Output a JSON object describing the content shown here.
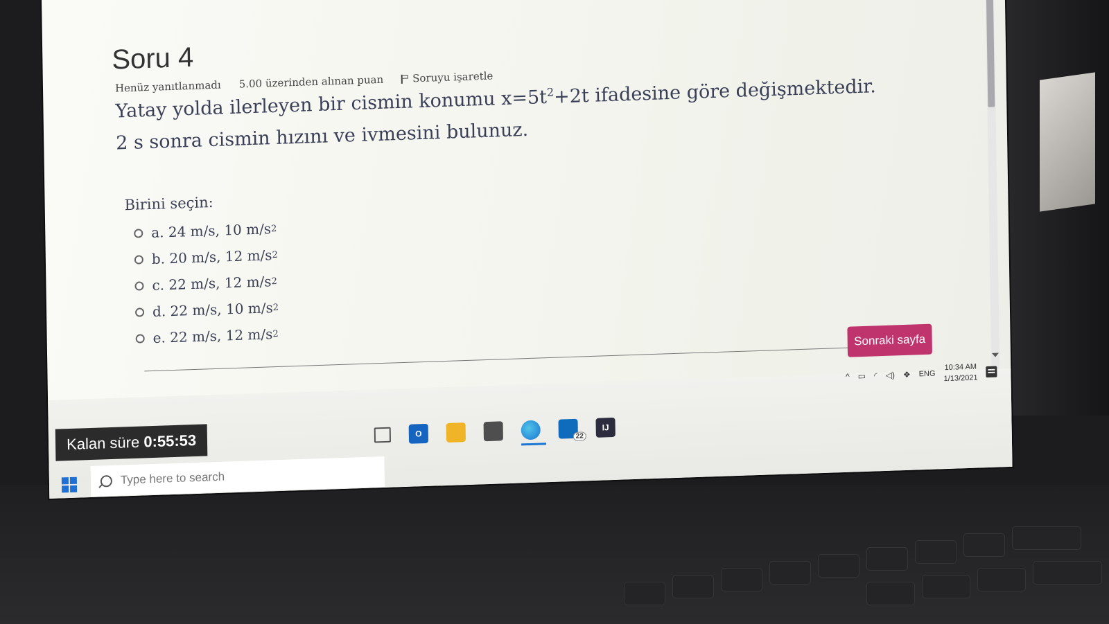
{
  "question": {
    "title": "Soru 4",
    "status": "Henüz yanıtlanmadı",
    "points": "5.00 üzerinden alınan puan",
    "flag_label": "Soruyu işaretle",
    "text_part1": "Yatay yolda ilerleyen bir cismin konumu x=5t",
    "text_exp1": "2",
    "text_part2": "+2t ifadesine göre değişmektedir. 2 s sonra cismin hızını ve ivmesini bulunuz."
  },
  "choose_label": "Birini seçin:",
  "answers": [
    {
      "label": "a. 24 m/s, 10 m/s",
      "exp": "2"
    },
    {
      "label": "b. 20 m/s, 12 m/s",
      "exp": "2"
    },
    {
      "label": "c. 22 m/s, 12 m/s",
      "exp": "2"
    },
    {
      "label": "d. 22 m/s, 10 m/s",
      "exp": "2"
    },
    {
      "label": "e. 22 m/s, 12 m/s",
      "exp": "2"
    }
  ],
  "next_button": "Sonraki sayfa",
  "timer": {
    "label": "Kalan süre",
    "value": "0:55:53"
  },
  "taskbar": {
    "search_placeholder": "Type here to search",
    "mail_badge": "22",
    "language": "ENG",
    "time": "10:34 AM",
    "date": "1/13/2021",
    "jetbrains_label": "IJ",
    "outlook_label": "O"
  },
  "colors": {
    "accent": "#c0346e",
    "text": "#3c4055"
  }
}
